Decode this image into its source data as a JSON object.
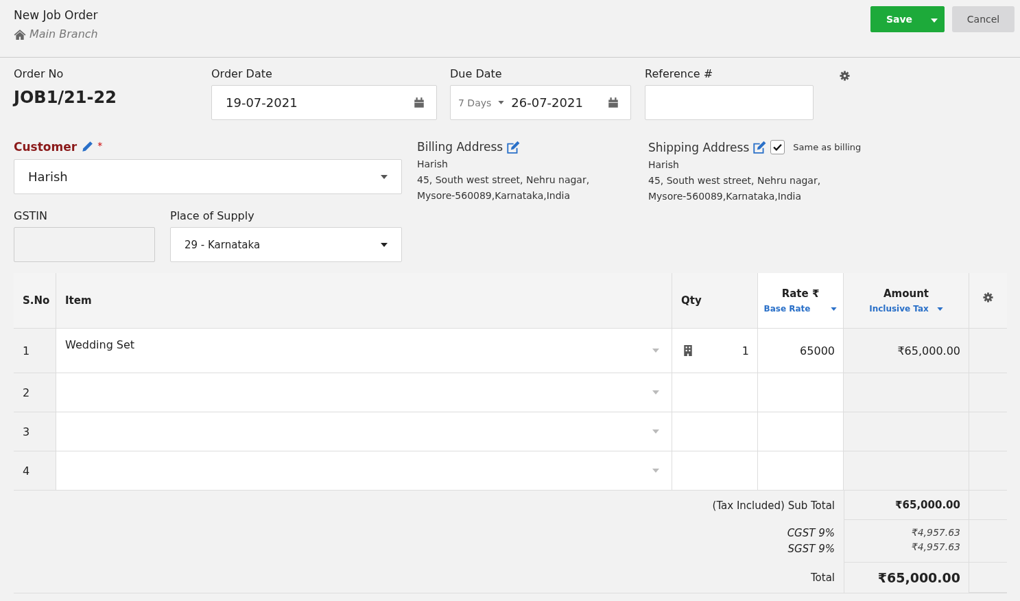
{
  "header": {
    "title": "New Job Order",
    "branch": "Main Branch",
    "save": "Save",
    "cancel": "Cancel"
  },
  "order_no": {
    "label": "Order No",
    "value": "JOB1/21-22"
  },
  "order_date": {
    "label": "Order Date",
    "value": "19-07-2021"
  },
  "due_date": {
    "label": "Due Date",
    "term": "7 Days",
    "value": "26-07-2021"
  },
  "reference": {
    "label": "Reference #"
  },
  "customer": {
    "label": "Customer",
    "required": "*",
    "value": "Harish"
  },
  "billing_address": {
    "label": "Billing Address",
    "lines": [
      "Harish",
      "45, South west street, Nehru nagar,",
      "Mysore-560089,Karnataka,India"
    ]
  },
  "shipping_address": {
    "label": "Shipping Address",
    "same_as_billing_label": "Same as billing",
    "same_as_billing": true,
    "lines": [
      "Harish",
      "45, South west street, Nehru nagar,",
      "Mysore-560089,Karnataka,India"
    ]
  },
  "gstin": {
    "label": "GSTIN"
  },
  "place_of_supply": {
    "label": "Place of Supply",
    "value": "29 - Karnataka"
  },
  "table": {
    "columns": [
      "S.No",
      "Item",
      "Qty",
      "Rate ₹",
      "Amount"
    ],
    "rate_mode": "Base Rate",
    "amount_mode": "Inclusive Tax",
    "rows": [
      {
        "sno": "1",
        "item": "Wedding Set",
        "qty": "1",
        "rate": "65000",
        "amount": "₹65,000.00"
      },
      {
        "sno": "2",
        "item": "",
        "qty": "",
        "rate": "",
        "amount": ""
      },
      {
        "sno": "3",
        "item": "",
        "qty": "",
        "rate": "",
        "amount": ""
      },
      {
        "sno": "4",
        "item": "",
        "qty": "",
        "rate": "",
        "amount": ""
      }
    ]
  },
  "totals": {
    "subtotal_label": "(Tax Included) Sub Total",
    "subtotal": "₹65,000.00",
    "taxes": [
      {
        "label": "CGST 9%",
        "value": "₹4,957.63"
      },
      {
        "label": "SGST 9%",
        "value": "₹4,957.63"
      }
    ],
    "total_label": "Total",
    "total": "₹65,000.00"
  }
}
